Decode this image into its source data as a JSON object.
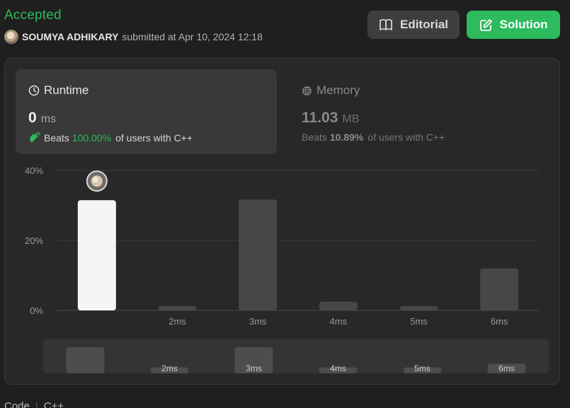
{
  "submission": {
    "status": "Accepted",
    "username": "SOUMYA ADHIKARY",
    "submitted_text": "submitted at Apr 10, 2024 12:18"
  },
  "buttons": {
    "editorial": "Editorial",
    "solution": "Solution"
  },
  "runtime": {
    "title": "Runtime",
    "value": "0",
    "unit": "ms",
    "beats_prefix": "Beats",
    "beats_pct": "100.00%",
    "beats_suffix": "of users with C++"
  },
  "memory": {
    "title": "Memory",
    "value": "11.03",
    "unit": "MB",
    "beats_prefix": "Beats",
    "beats_pct": "10.89%",
    "beats_suffix": "of users with C++"
  },
  "chart_data": {
    "type": "bar",
    "categories": [
      "",
      "2ms",
      "3ms",
      "4ms",
      "5ms",
      "6ms"
    ],
    "values": [
      31.5,
      1.2,
      31.7,
      2.5,
      1.2,
      12.0
    ],
    "highlighted_index": 0,
    "yticks": [
      "0%",
      "20%",
      "40%"
    ],
    "ylim": [
      0,
      40
    ],
    "grid": true,
    "mini_values": [
      35,
      8,
      35,
      8,
      8,
      13
    ]
  },
  "colors": {
    "accent_green": "#2cbb5d",
    "bar": "#474747",
    "bar_highlight": "#f5f5f5"
  },
  "code": {
    "label": "Code",
    "language": "C++"
  }
}
